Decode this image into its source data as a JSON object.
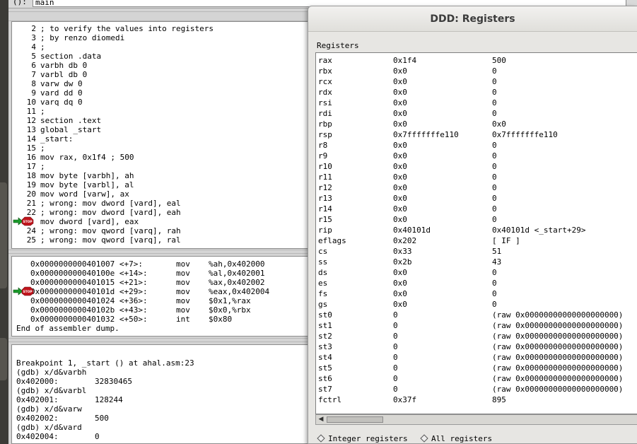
{
  "arg_bar": {
    "label": "():",
    "value": "main"
  },
  "source": [
    {
      "num": "2",
      "text": "; to verify the values into registers"
    },
    {
      "num": "3",
      "text": "; by renzo diomedi"
    },
    {
      "num": "4",
      "text": ";"
    },
    {
      "num": "5",
      "text": "section .data"
    },
    {
      "num": "6",
      "text": "varbh db 0"
    },
    {
      "num": "7",
      "text": "varbl db 0"
    },
    {
      "num": "8",
      "text": "varw dw 0"
    },
    {
      "num": "9",
      "text": "vard dd 0"
    },
    {
      "num": "10",
      "text": "varq dq 0"
    },
    {
      "num": "11",
      "text": ";"
    },
    {
      "num": "12",
      "text": "section .text"
    },
    {
      "num": "13",
      "text": "global _start"
    },
    {
      "num": "14",
      "text": "_start:"
    },
    {
      "num": "15",
      "text": ";"
    },
    {
      "num": "16",
      "text": "mov rax, 0x1f4 ; 500"
    },
    {
      "num": "17",
      "text": ";"
    },
    {
      "num": "18",
      "text": "mov byte [varbh], ah"
    },
    {
      "num": "19",
      "text": "mov byte [varbl], al"
    },
    {
      "num": "20",
      "text": "mov word [varw], ax"
    },
    {
      "num": "21",
      "text": "; wrong: mov dword [vard], eal"
    },
    {
      "num": "22",
      "text": "; wrong: mov dword [vard], eah"
    },
    {
      "num": "23",
      "text": "mov dword [vard], eax"
    },
    {
      "num": "24",
      "text": "; wrong: mov qword [varq], rah"
    },
    {
      "num": "25",
      "text": "; wrong: mov qword [varq], ral"
    }
  ],
  "assembly": [
    {
      "addr": "0x0000000000401007 <+7>:",
      "mn": "mov",
      "op": "%ah,0x402000"
    },
    {
      "addr": "0x000000000040100e <+14>:",
      "mn": "mov",
      "op": "%al,0x402001"
    },
    {
      "addr": "0x0000000000401015 <+21>:",
      "mn": "mov",
      "op": "%ax,0x402002"
    },
    {
      "addr": "0x000000000040101d <+29>:",
      "mn": "mov",
      "op": "%eax,0x402004"
    },
    {
      "addr": "0x0000000000401024 <+36>:",
      "mn": "mov",
      "op": "$0x1,%rax"
    },
    {
      "addr": "0x000000000040102b <+43>:",
      "mn": "mov",
      "op": "$0x0,%rbx"
    },
    {
      "addr": "0x0000000000401032 <+50>:",
      "mn": "int",
      "op": "$0x80"
    }
  ],
  "assembly_end": "End of assembler dump.",
  "console": [
    {
      "text": "Breakpoint 1, _start () at ahal.asm:23",
      "val": ""
    },
    {
      "text": "(gdb) x/d&varbh",
      "val": ""
    },
    {
      "text": "0x402000:",
      "val": "32830465"
    },
    {
      "text": "(gdb) x/d&varbl",
      "val": ""
    },
    {
      "text": "0x402001:",
      "val": "128244"
    },
    {
      "text": "(gdb) x/d&varw",
      "val": ""
    },
    {
      "text": "0x402002:",
      "val": "500"
    },
    {
      "text": "(gdb) x/d&vard",
      "val": ""
    },
    {
      "text": "0x402004:",
      "val": "0"
    }
  ],
  "breakpoint": {
    "icon": "stop-sign-icon",
    "label": "STOP",
    "source_line": "23",
    "asm_index": 3,
    "color": "#c0141c",
    "arrow_color": "#1a9a2a"
  },
  "registers_dialog": {
    "title": "DDD: Registers",
    "group_label": "Registers",
    "rows": [
      {
        "name": "rax",
        "raw": "0x1f4",
        "natural": "500"
      },
      {
        "name": "rbx",
        "raw": "0x0",
        "natural": "0"
      },
      {
        "name": "rcx",
        "raw": "0x0",
        "natural": "0"
      },
      {
        "name": "rdx",
        "raw": "0x0",
        "natural": "0"
      },
      {
        "name": "rsi",
        "raw": "0x0",
        "natural": "0"
      },
      {
        "name": "rdi",
        "raw": "0x0",
        "natural": "0"
      },
      {
        "name": "rbp",
        "raw": "0x0",
        "natural": "0x0"
      },
      {
        "name": "rsp",
        "raw": "0x7fffffffe110",
        "natural": "0x7fffffffe110"
      },
      {
        "name": "r8",
        "raw": "0x0",
        "natural": "0"
      },
      {
        "name": "r9",
        "raw": "0x0",
        "natural": "0"
      },
      {
        "name": "r10",
        "raw": "0x0",
        "natural": "0"
      },
      {
        "name": "r11",
        "raw": "0x0",
        "natural": "0"
      },
      {
        "name": "r12",
        "raw": "0x0",
        "natural": "0"
      },
      {
        "name": "r13",
        "raw": "0x0",
        "natural": "0"
      },
      {
        "name": "r14",
        "raw": "0x0",
        "natural": "0"
      },
      {
        "name": "r15",
        "raw": "0x0",
        "natural": "0"
      },
      {
        "name": "rip",
        "raw": "0x40101d",
        "natural": "0x40101d <_start+29>"
      },
      {
        "name": "eflags",
        "raw": "0x202",
        "natural": "[ IF ]"
      },
      {
        "name": "cs",
        "raw": "0x33",
        "natural": "51"
      },
      {
        "name": "ss",
        "raw": "0x2b",
        "natural": "43"
      },
      {
        "name": "ds",
        "raw": "0x0",
        "natural": "0"
      },
      {
        "name": "es",
        "raw": "0x0",
        "natural": "0"
      },
      {
        "name": "fs",
        "raw": "0x0",
        "natural": "0"
      },
      {
        "name": "gs",
        "raw": "0x0",
        "natural": "0"
      },
      {
        "name": "st0",
        "raw": "0",
        "natural": "(raw 0x00000000000000000000)"
      },
      {
        "name": "st1",
        "raw": "0",
        "natural": "(raw 0x00000000000000000000)"
      },
      {
        "name": "st2",
        "raw": "0",
        "natural": "(raw 0x00000000000000000000)"
      },
      {
        "name": "st3",
        "raw": "0",
        "natural": "(raw 0x00000000000000000000)"
      },
      {
        "name": "st4",
        "raw": "0",
        "natural": "(raw 0x00000000000000000000)"
      },
      {
        "name": "st5",
        "raw": "0",
        "natural": "(raw 0x00000000000000000000)"
      },
      {
        "name": "st6",
        "raw": "0",
        "natural": "(raw 0x00000000000000000000)"
      },
      {
        "name": "st7",
        "raw": "0",
        "natural": "(raw 0x00000000000000000000)"
      },
      {
        "name": "fctrl",
        "raw": "0x37f",
        "natural": "895"
      }
    ],
    "radio_integer": "Integer registers",
    "radio_all": "All registers"
  }
}
